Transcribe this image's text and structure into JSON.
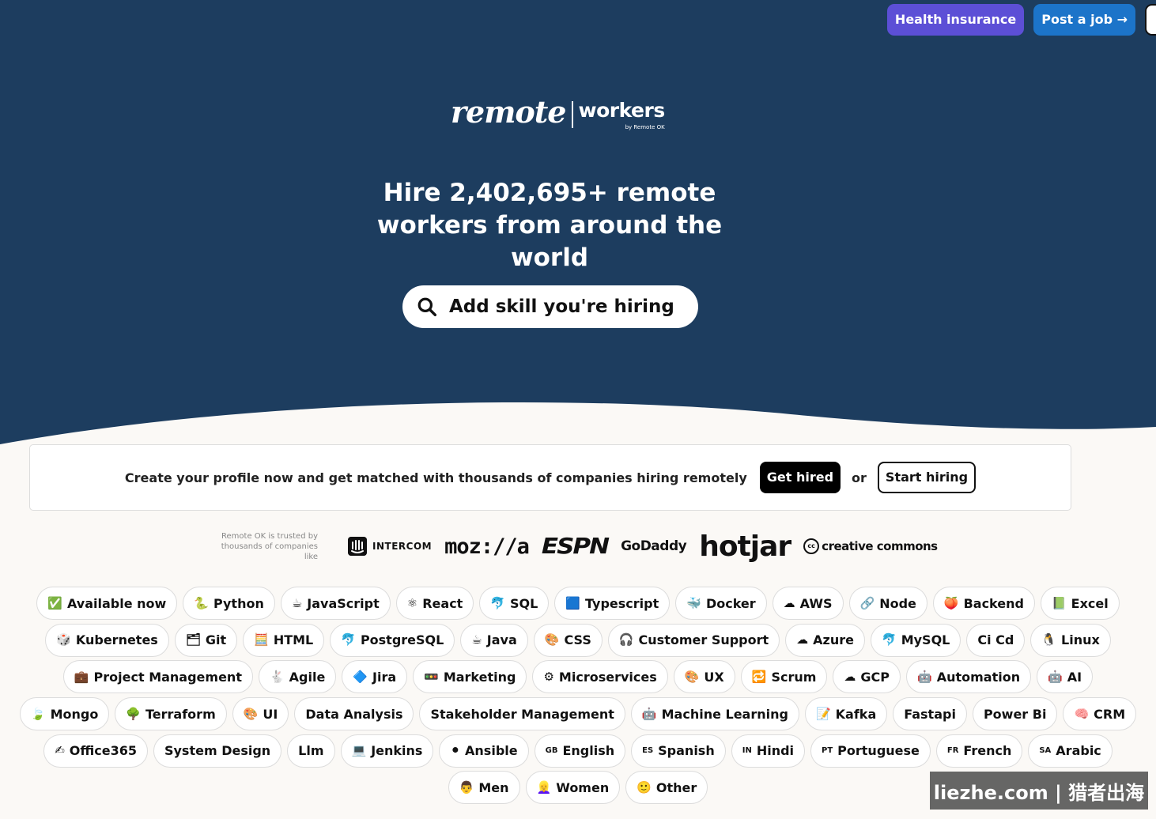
{
  "header": {
    "health_insurance_label": "Health insurance",
    "post_job_label": "Post a job →"
  },
  "logo": {
    "remote": "remote",
    "workers": "workers",
    "by": "by Remote OK"
  },
  "hero": {
    "headline": "Hire 2,402,695+ remote workers from around the world",
    "search_placeholder": "Add skill you're hiring"
  },
  "cta": {
    "text": "Create your profile now and get matched with thousands of companies hiring remotely",
    "get_hired_label": "Get hired",
    "or_text": "or",
    "start_hiring_label": "Start hiring"
  },
  "trusted": {
    "text": "Remote OK is trusted by thousands of companies like",
    "logos": [
      "INTERCOM",
      "moz://a",
      "ESPN",
      "GoDaddy",
      "hotjar",
      "creative commons"
    ]
  },
  "tag_rows": [
    [
      {
        "emoji": "✅",
        "label": "Available now"
      },
      {
        "emoji": "🐍",
        "label": "Python"
      },
      {
        "emoji": "☕",
        "label": "JavaScript"
      },
      {
        "emoji": "⚛",
        "label": "React"
      },
      {
        "emoji": "🐬",
        "label": "SQL"
      },
      {
        "emoji": "🟦",
        "label": "Typescript"
      },
      {
        "emoji": "🐳",
        "label": "Docker"
      },
      {
        "emoji": "☁",
        "label": "AWS"
      },
      {
        "emoji": "🔗",
        "label": "Node"
      },
      {
        "emoji": "🍑",
        "label": "Backend"
      },
      {
        "emoji": "📗",
        "label": "Excel"
      }
    ],
    [
      {
        "emoji": "🎲",
        "label": "Kubernetes"
      },
      {
        "emoji": "🗂",
        "label": "Git"
      },
      {
        "emoji": "🧮",
        "label": "HTML"
      },
      {
        "emoji": "🐬",
        "label": "PostgreSQL"
      },
      {
        "emoji": "☕",
        "label": "Java"
      },
      {
        "emoji": "🎨",
        "label": "CSS"
      },
      {
        "emoji": "🎧",
        "label": "Customer Support"
      },
      {
        "emoji": "☁",
        "label": "Azure"
      },
      {
        "emoji": "🐬",
        "label": "MySQL"
      },
      {
        "emoji": "",
        "label": "Ci Cd"
      },
      {
        "emoji": "🐧",
        "label": "Linux"
      }
    ],
    [
      {
        "emoji": "💼",
        "label": "Project Management"
      },
      {
        "emoji": "🐇",
        "label": "Agile"
      },
      {
        "emoji": "🔷",
        "label": "Jira"
      },
      {
        "emoji": "🚥",
        "label": "Marketing"
      },
      {
        "emoji": "⚙",
        "label": "Microservices"
      },
      {
        "emoji": "🎨",
        "label": "UX"
      },
      {
        "emoji": "🔁",
        "label": "Scrum"
      },
      {
        "emoji": "☁",
        "label": "GCP"
      },
      {
        "emoji": "🤖",
        "label": "Automation"
      },
      {
        "emoji": "🤖",
        "label": "AI"
      }
    ],
    [
      {
        "emoji": "🍃",
        "label": "Mongo"
      },
      {
        "emoji": "🌳",
        "label": "Terraform"
      },
      {
        "emoji": "🎨",
        "label": "UI"
      },
      {
        "emoji": "",
        "label": "Data Analysis"
      },
      {
        "emoji": "",
        "label": "Stakeholder Management"
      },
      {
        "emoji": "🤖",
        "label": "Machine Learning"
      },
      {
        "emoji": "📝",
        "label": "Kafka"
      },
      {
        "emoji": "",
        "label": "Fastapi"
      },
      {
        "emoji": "",
        "label": "Power Bi"
      },
      {
        "emoji": "🧠",
        "label": "CRM"
      }
    ],
    [
      {
        "emoji": "✍",
        "label": "Office365"
      },
      {
        "emoji": "",
        "label": "System Design"
      },
      {
        "emoji": "",
        "label": "Llm"
      },
      {
        "emoji": "💻",
        "label": "Jenkins"
      },
      {
        "emoji": "⚫",
        "label": "Ansible"
      },
      {
        "emoji": "GB",
        "label": "English"
      },
      {
        "emoji": "ES",
        "label": "Spanish"
      },
      {
        "emoji": "IN",
        "label": "Hindi"
      },
      {
        "emoji": "PT",
        "label": "Portuguese"
      },
      {
        "emoji": "FR",
        "label": "French"
      },
      {
        "emoji": "SA",
        "label": "Arabic"
      }
    ],
    [
      {
        "emoji": "👨",
        "label": "Men"
      },
      {
        "emoji": "👱‍♀",
        "label": "Women"
      },
      {
        "emoji": "🙂",
        "label": "Other"
      }
    ]
  ],
  "watermark": "liezhe.com | 猎者出海"
}
